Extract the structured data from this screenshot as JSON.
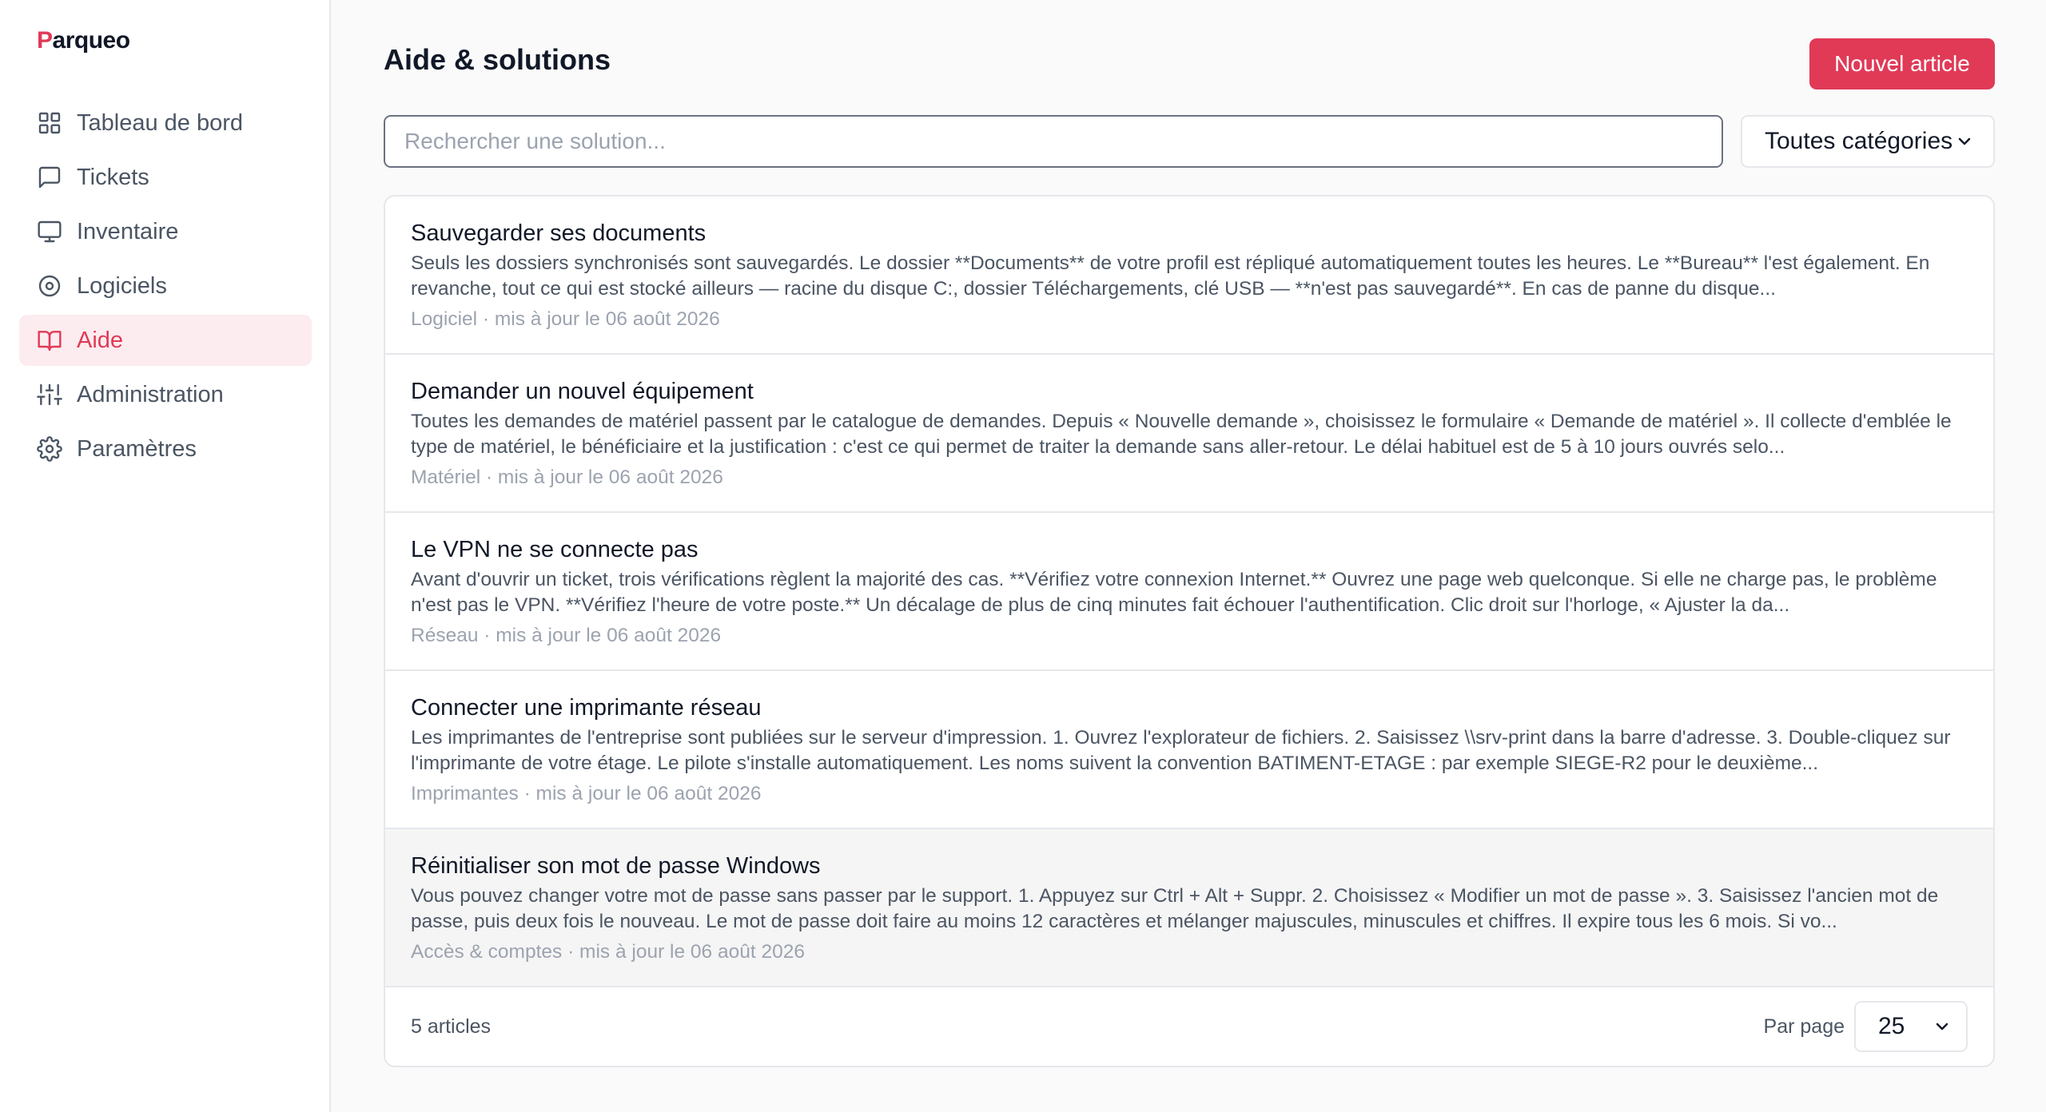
{
  "brand": {
    "mark": "P",
    "rest": "arqueo",
    "accent": "#e03a57"
  },
  "sidebar": {
    "items": [
      {
        "label": "Tableau de bord",
        "icon": "dashboard-grid-icon",
        "active": false
      },
      {
        "label": "Tickets",
        "icon": "message-square-icon",
        "active": false
      },
      {
        "label": "Inventaire",
        "icon": "monitor-icon",
        "active": false
      },
      {
        "label": "Logiciels",
        "icon": "disc-icon",
        "active": false
      },
      {
        "label": "Aide",
        "icon": "book-open-icon",
        "active": true
      },
      {
        "label": "Administration",
        "icon": "sliders-icon",
        "active": false
      },
      {
        "label": "Paramètres",
        "icon": "gear-icon",
        "active": false
      }
    ]
  },
  "header": {
    "title": "Aide & solutions",
    "new_button": "Nouvel article"
  },
  "search": {
    "placeholder": "Rechercher une solution...",
    "value": ""
  },
  "category_filter": {
    "selected": "Toutes catégories"
  },
  "articles": [
    {
      "title": "Sauvegarder ses documents",
      "excerpt": "Seuls les dossiers synchronisés sont sauvegardés. Le dossier **Documents** de votre profil est répliqué automatiquement toutes les heures. Le **Bureau** l'est également. En revanche, tout ce qui est stocké ailleurs — racine du disque C:, dossier Téléchargements, clé USB — **n'est pas sauvegardé**. En cas de panne du disque...",
      "meta": "Logiciel · mis à jour le 06 août 2026"
    },
    {
      "title": "Demander un nouvel équipement",
      "excerpt": "Toutes les demandes de matériel passent par le catalogue de demandes. Depuis « Nouvelle demande », choisissez le formulaire « Demande de matériel ». Il collecte d'emblée le type de matériel, le bénéficiaire et la justification : c'est ce qui permet de traiter la demande sans aller-retour. Le délai habituel est de 5 à 10 jours ouvrés selo...",
      "meta": "Matériel · mis à jour le 06 août 2026"
    },
    {
      "title": "Le VPN ne se connecte pas",
      "excerpt": "Avant d'ouvrir un ticket, trois vérifications règlent la majorité des cas. **Vérifiez votre connexion Internet.** Ouvrez une page web quelconque. Si elle ne charge pas, le problème n'est pas le VPN. **Vérifiez l'heure de votre poste.** Un décalage de plus de cinq minutes fait échouer l'authentification. Clic droit sur l'horloge, « Ajuster la da...",
      "meta": "Réseau · mis à jour le 06 août 2026"
    },
    {
      "title": "Connecter une imprimante réseau",
      "excerpt": "Les imprimantes de l'entreprise sont publiées sur le serveur d'impression. 1. Ouvrez l'explorateur de fichiers. 2. Saisissez \\\\srv-print dans la barre d'adresse. 3. Double-cliquez sur l'imprimante de votre étage. Le pilote s'installe automatiquement. Les noms suivent la convention BATIMENT-ETAGE : par exemple SIEGE-R2 pour le deuxième...",
      "meta": "Imprimantes · mis à jour le 06 août 2026"
    },
    {
      "title": "Réinitialiser son mot de passe Windows",
      "excerpt": "Vous pouvez changer votre mot de passe sans passer par le support. 1. Appuyez sur Ctrl + Alt + Suppr. 2. Choisissez « Modifier un mot de passe ». 3. Saisissez l'ancien mot de passe, puis deux fois le nouveau. Le mot de passe doit faire au moins 12 caractères et mélanger majuscules, minuscules et chiffres. Il expire tous les 6 mois. Si vo...",
      "meta": "Accès & comptes · mis à jour le 06 août 2026"
    }
  ],
  "footer": {
    "count": "5 articles",
    "per_page_label": "Par page",
    "per_page_value": "25"
  }
}
